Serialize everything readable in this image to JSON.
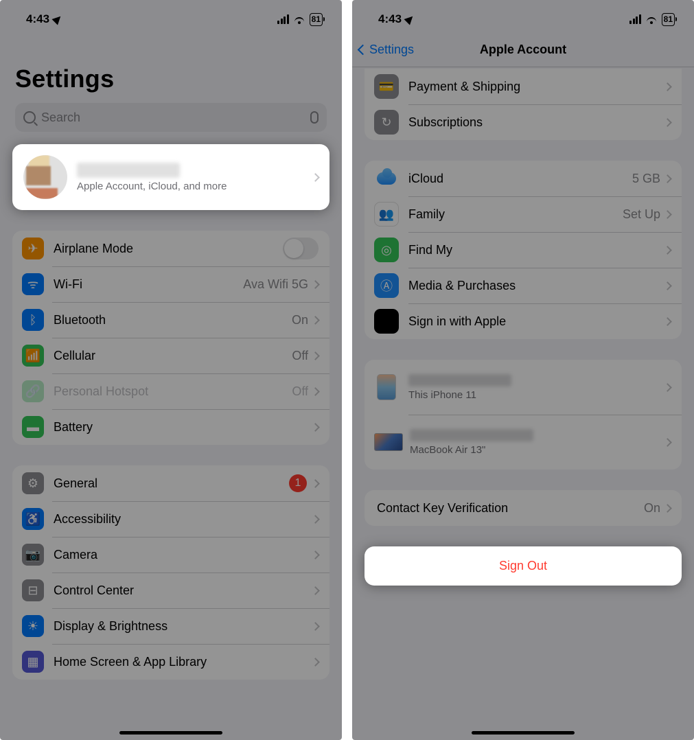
{
  "status": {
    "time": "4:43",
    "battery": "81"
  },
  "left": {
    "title": "Settings",
    "search_placeholder": "Search",
    "profile": {
      "subtitle": "Apple Account, iCloud, and more"
    },
    "connectivity": [
      {
        "name": "airplane",
        "label": "Airplane Mode",
        "value": "",
        "icon": "ic-plane",
        "glyph": "✈"
      },
      {
        "name": "wifi",
        "label": "Wi-Fi",
        "value": "Ava Wifi 5G",
        "icon": "ic-wifi",
        "glyph": "ᯤ"
      },
      {
        "name": "bluetooth",
        "label": "Bluetooth",
        "value": "On",
        "icon": "ic-bt",
        "glyph": "ᛒ"
      },
      {
        "name": "cellular",
        "label": "Cellular",
        "value": "Off",
        "icon": "ic-cell",
        "glyph": "📶"
      },
      {
        "name": "hotspot",
        "label": "Personal Hotspot",
        "value": "Off",
        "icon": "ic-hot",
        "glyph": "🔗",
        "disabled": true
      },
      {
        "name": "battery",
        "label": "Battery",
        "value": "",
        "icon": "ic-batt",
        "glyph": "▬"
      }
    ],
    "general": [
      {
        "name": "general",
        "label": "General",
        "icon": "ic-gen",
        "glyph": "⚙",
        "badge": "1"
      },
      {
        "name": "accessibility",
        "label": "Accessibility",
        "icon": "ic-acc",
        "glyph": "♿"
      },
      {
        "name": "camera",
        "label": "Camera",
        "icon": "ic-cam",
        "glyph": "📷"
      },
      {
        "name": "controlcenter",
        "label": "Control Center",
        "icon": "ic-cc",
        "glyph": "⊟"
      },
      {
        "name": "display",
        "label": "Display & Brightness",
        "icon": "ic-disp",
        "glyph": "☀"
      },
      {
        "name": "homescreen",
        "label": "Home Screen & App Library",
        "icon": "ic-home",
        "glyph": "▦"
      }
    ]
  },
  "right": {
    "back": "Settings",
    "title": "Apple Account",
    "top_rows": [
      {
        "name": "payment",
        "label": "Payment & Shipping",
        "icon": "ic-card",
        "glyph": "💳"
      },
      {
        "name": "subscriptions",
        "label": "Subscriptions",
        "icon": "ic-sub",
        "glyph": "↻"
      }
    ],
    "services": [
      {
        "name": "icloud",
        "label": "iCloud",
        "value": "5 GB",
        "icon": "ic-cloud",
        "cloud": true
      },
      {
        "name": "family",
        "label": "Family",
        "value": "Set Up",
        "icon": "ic-fam",
        "glyph": "👥"
      },
      {
        "name": "findmy",
        "label": "Find My",
        "value": "",
        "icon": "ic-find",
        "glyph": "◎"
      },
      {
        "name": "media",
        "label": "Media & Purchases",
        "value": "",
        "icon": "ic-media",
        "glyph": "Ⓐ"
      },
      {
        "name": "siwa",
        "label": "Sign in with Apple",
        "value": "",
        "icon": "ic-siwa",
        "glyph": ""
      }
    ],
    "devices": [
      {
        "name": "iphone",
        "sub": "This iPhone 11"
      },
      {
        "name": "macbook",
        "sub": "MacBook Air 13\""
      }
    ],
    "contact_key": {
      "label": "Contact Key Verification",
      "value": "On"
    },
    "signout": "Sign Out"
  }
}
